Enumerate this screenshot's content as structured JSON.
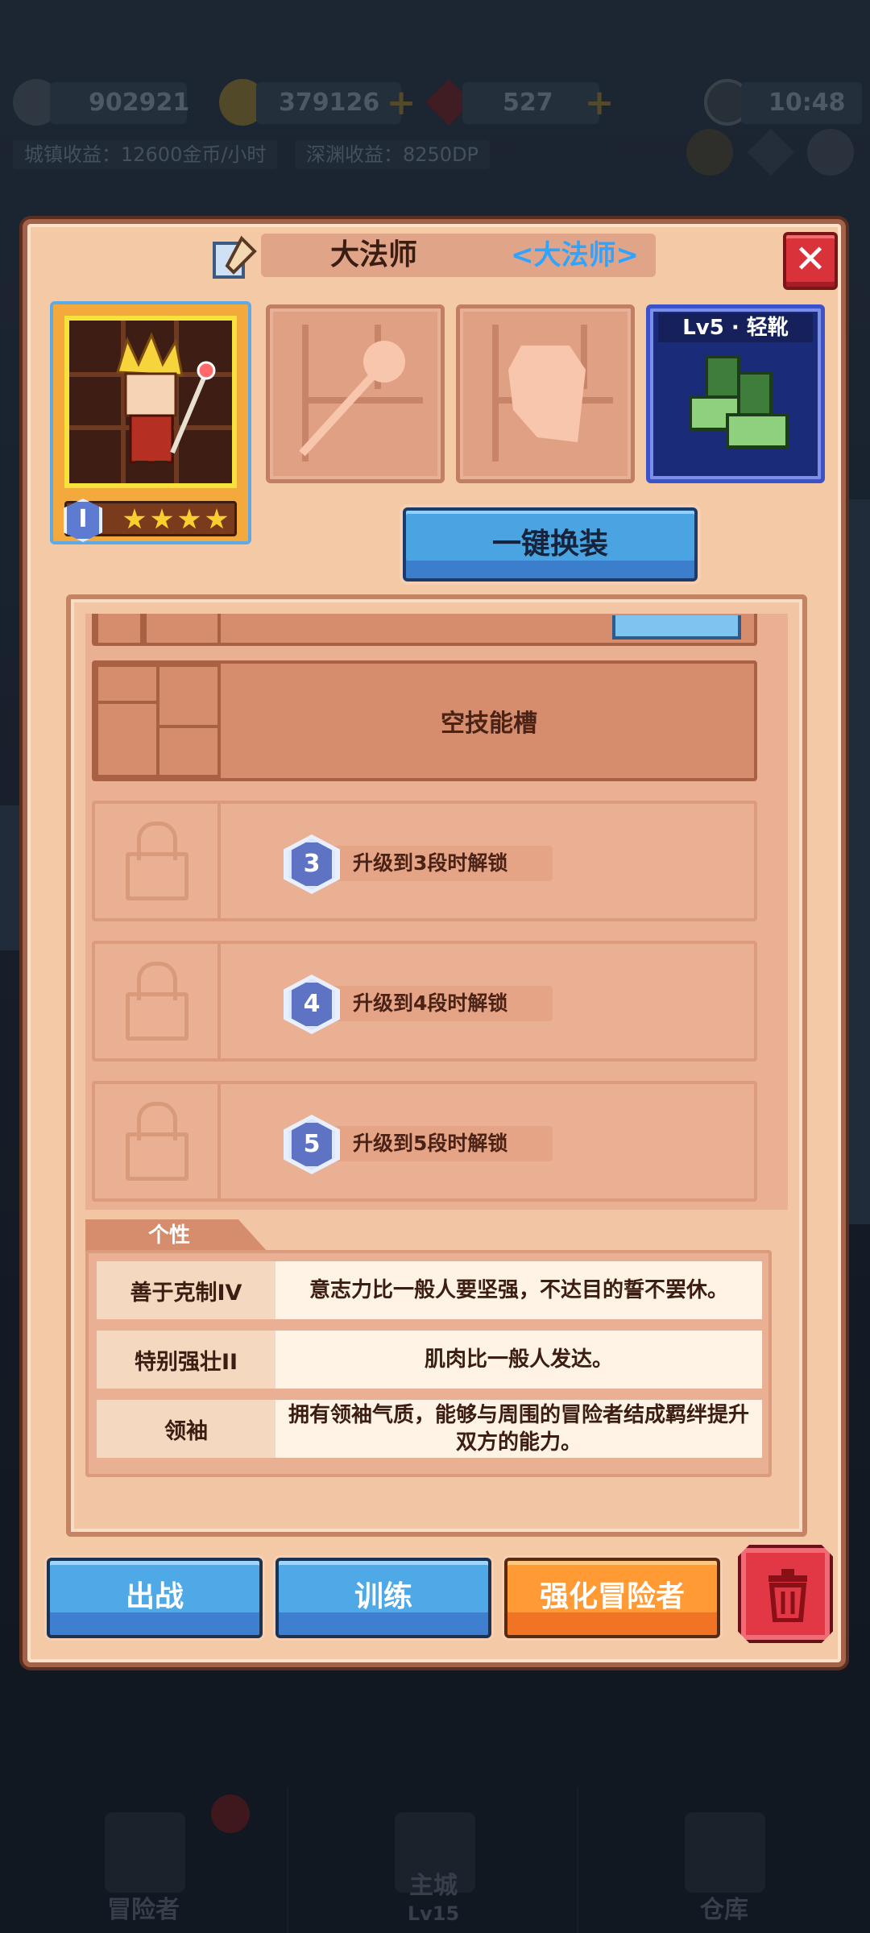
{
  "hud": {
    "power": "902921",
    "gold": "379126",
    "gems": "527",
    "time": "10:48",
    "town_income": "城镇收益：12600金币/小时",
    "abyss_income": "深渊收益：8250DP"
  },
  "bottom_nav": {
    "items": [
      {
        "label": "冒险者"
      },
      {
        "label": "主城",
        "sub": "Lv15"
      },
      {
        "label": "仓库"
      }
    ]
  },
  "modal": {
    "hero_name": "大法师",
    "hero_class": "<大法师>",
    "close_label": "✕",
    "hero_rank": "I",
    "hero_stars": 4,
    "boots_label": "Lv5 · 轻靴",
    "equip_button": "一键换装",
    "skills": {
      "empty_slot_label": "空技能槽",
      "locked": [
        {
          "tier": "3",
          "text": "升级到3段时解锁"
        },
        {
          "tier": "4",
          "text": "升级到4段时解锁"
        },
        {
          "tier": "5",
          "text": "升级到5段时解锁"
        }
      ]
    },
    "traits": {
      "title": "个性",
      "items": [
        {
          "name": "善于克制IV",
          "desc": "意志力比一般人要坚强，不达目的誓不罢休。"
        },
        {
          "name": "特别强壮II",
          "desc": "肌肉比一般人发达。"
        },
        {
          "name": "领袖",
          "desc": "拥有领袖气质，能够与周围的冒险者结成羁绊提升双方的能力。"
        }
      ]
    },
    "actions": {
      "battle": "出战",
      "train": "训练",
      "upgrade": "强化冒险者"
    }
  },
  "colors": {
    "accent_blue": "#4fa9e6",
    "accent_orange": "#ff9a34",
    "danger_red": "#e23745",
    "class_text": "#2ea3ff"
  }
}
